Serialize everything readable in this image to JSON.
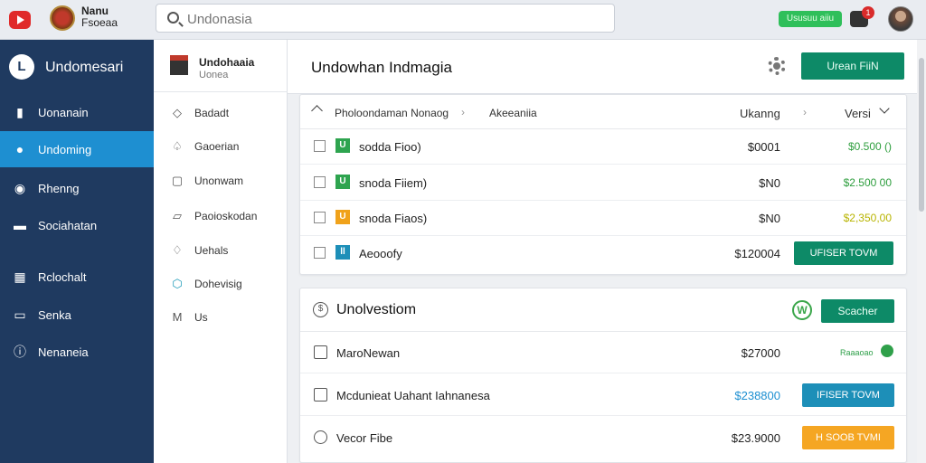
{
  "topbar": {
    "brand_line1": "Nanu",
    "brand_line2": "Fsoeaa",
    "search_placeholder": "Undonasia",
    "status_pill": "Ususuu aiiu",
    "notification_count": "1"
  },
  "nav": {
    "title": "Undomesari",
    "logo_glyph": "L",
    "items": [
      {
        "label": "Uonanain",
        "icon": "building-icon",
        "active": false
      },
      {
        "label": "Undoming",
        "icon": "user-badge-icon",
        "active": true
      },
      {
        "label": "Rhenng",
        "icon": "account-icon",
        "active": false
      },
      {
        "label": "Sociahatan",
        "icon": "truck-icon",
        "active": false
      },
      {
        "label": "Rclochalt",
        "icon": "grid-icon",
        "active": false
      },
      {
        "label": "Senka",
        "icon": "card-icon",
        "active": false
      },
      {
        "label": "Nenaneia",
        "icon": "info-icon",
        "active": false
      }
    ]
  },
  "subnav": {
    "title": "Undohaaia",
    "subtitle": "Uonea",
    "items": [
      {
        "label": "Badadt",
        "icon": "diamond-icon"
      },
      {
        "label": "Gaoerian",
        "icon": "bell-icon"
      },
      {
        "label": "Unonwam",
        "icon": "lock-icon"
      },
      {
        "label": "Paoioskodan",
        "icon": "folder-icon"
      },
      {
        "label": "Uehals",
        "icon": "flame-icon"
      },
      {
        "label": "Dohevisig",
        "icon": "shield-icon"
      },
      {
        "label": "Us",
        "icon": "mail-icon"
      }
    ]
  },
  "main": {
    "title": "Undowhan Indmagia",
    "primary_button": "Urean FiiN"
  },
  "table": {
    "header": {
      "col1": "Pholoondaman Nonaog",
      "col2": "Akeeaniia",
      "col3": "Ukanng",
      "col4": "Versi"
    },
    "rows": [
      {
        "tag": "U",
        "tag_color": "#2ea44f",
        "name": "sodda Fioo)",
        "amount": "$0001",
        "value": "$0.500 ()",
        "value_color": "#2e9e3e",
        "button": ""
      },
      {
        "tag": "U",
        "tag_color": "#2ea44f",
        "name": "snoda Fiiem)",
        "amount": "$N0",
        "value": "$2.500 00",
        "value_color": "#2e9e3e",
        "button": ""
      },
      {
        "tag": "U",
        "tag_color": "#f0a21b",
        "name": "snoda Fiaos)",
        "amount": "$N0",
        "value": "$2,350,00",
        "value_color": "#b8b400",
        "button": ""
      },
      {
        "tag": "ll",
        "tag_color": "#1d8fb8",
        "name": "Aeooofy",
        "amount": "$120004",
        "value": "",
        "value_color": "",
        "button": "UFISER TOVM",
        "button_color": "#0d8a67"
      }
    ]
  },
  "section": {
    "title": "Unolvestiom",
    "button": "Scacher",
    "rows": [
      {
        "name": "MaroNewan",
        "amount": "$27000",
        "amount_color": "#222222",
        "link": "Raaaoao",
        "button": "",
        "icon": "chart-icon"
      },
      {
        "name": "Mcdunieat Uahant Iahnanesa",
        "amount": "$238800",
        "amount_color": "#1d8fd1",
        "link": "",
        "button": "IFISER TOVM",
        "button_color": "#1d8fb8",
        "icon": "document-icon"
      },
      {
        "name": "Vecor Fibe",
        "amount": "$23.9000",
        "amount_color": "#222222",
        "link": "",
        "button": "H SOOB TVMI",
        "button_color": "#f5a623",
        "icon": "clock-icon"
      }
    ]
  }
}
